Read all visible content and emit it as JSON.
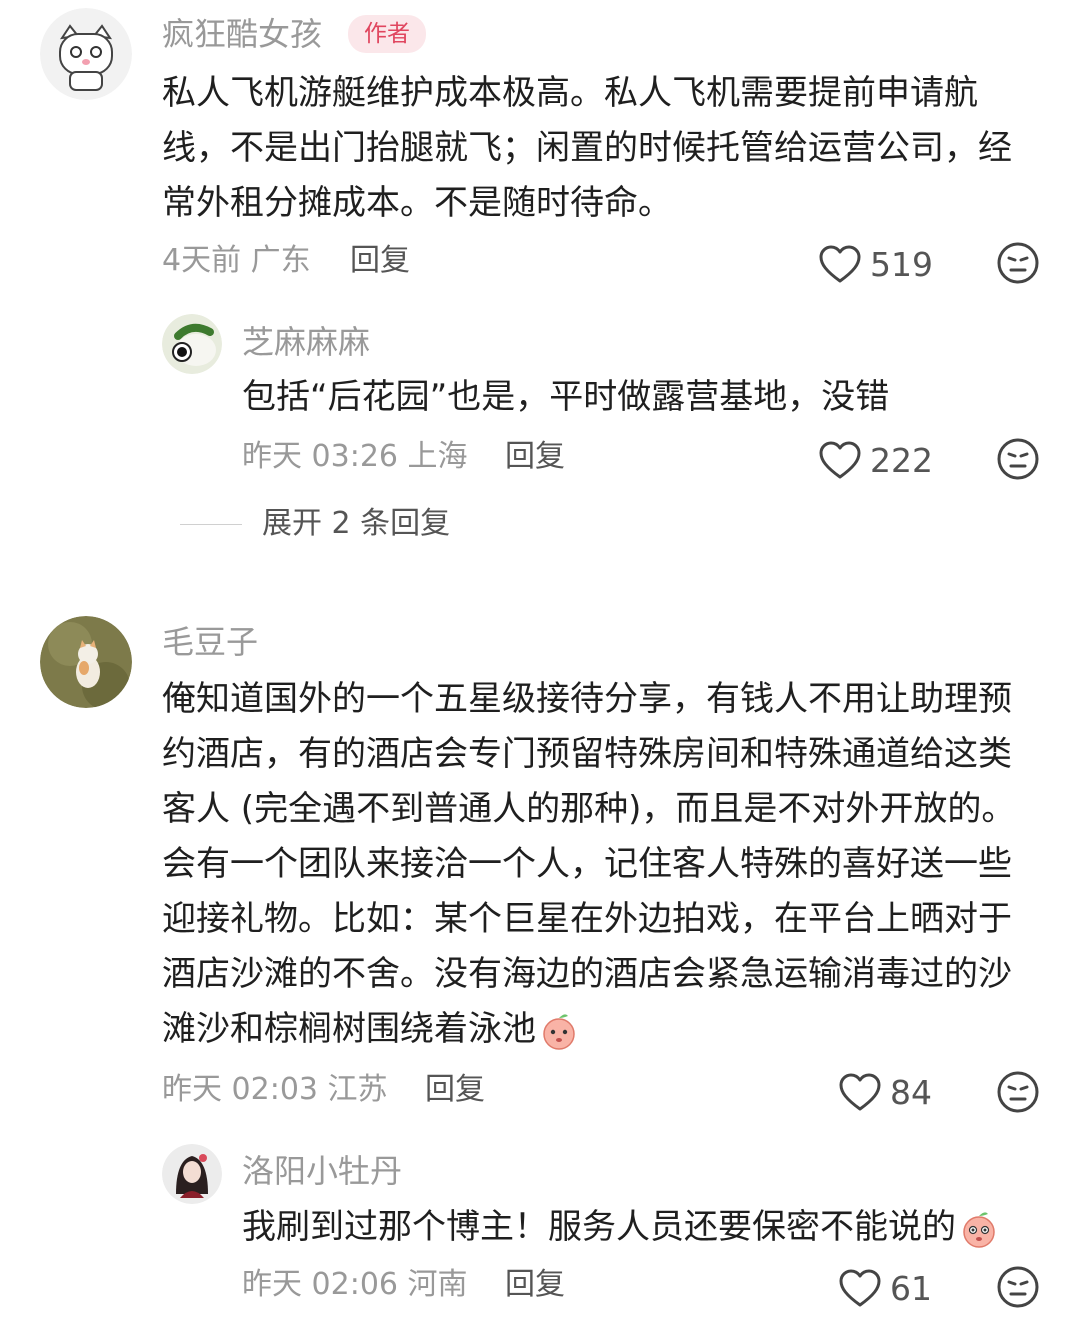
{
  "comments": [
    {
      "author": "疯狂酷女孩",
      "author_badge": "作者",
      "text": "私人飞机游艇维护成本极高。私人飞机需要提前申请航线，不是出门抬腿就飞；闲置的时候托管给运营公司，经常外租分摊成本。不是随时待命。",
      "time_location": "4天前 广东",
      "reply_label": "回复",
      "likes": "519",
      "replies": [
        {
          "author": "芝麻麻麻",
          "text": "包括“后花园”也是，平时做露营基地，没错",
          "time_location": "昨天 03:26 上海",
          "reply_label": "回复",
          "likes": "222"
        }
      ],
      "expand_label": "展开 2 条回复"
    },
    {
      "author": "毛豆子",
      "text": "俺知道国外的一个五星级接待分享，有钱人不用让助理预约酒店，有的酒店会专门预留特殊房间和特殊通道给这类客人 (完全遇不到普通人的那种)，而且是不对外开放的。会有一个团队来接洽一个人，记住客人特殊的喜好送一些迎接礼物。比如：某个巨星在外边拍戏，在平台上晒对于酒店沙滩的不舍。没有海边的酒店会紧急运输消毒过的沙滩沙和棕榈树围绕着泳池",
      "time_location": "昨天 02:03 江苏",
      "reply_label": "回复",
      "likes": "84",
      "replies": [
        {
          "author": "洛阳小牡丹",
          "text": "我刷到过那个博主！服务人员还要保密不能说的",
          "time_location": "昨天 02:06 河南",
          "reply_label": "回复",
          "likes": "61"
        }
      ]
    }
  ],
  "icons": {
    "like": "heart-outline-icon",
    "dislike": "neutral-face-icon",
    "emoji": "peach-emoji-icon"
  },
  "colors": {
    "name": "#999999",
    "badge_bg": "#fbe7ea",
    "badge_text": "#e0465f",
    "text": "#1f1f1f",
    "meta": "#999999"
  }
}
